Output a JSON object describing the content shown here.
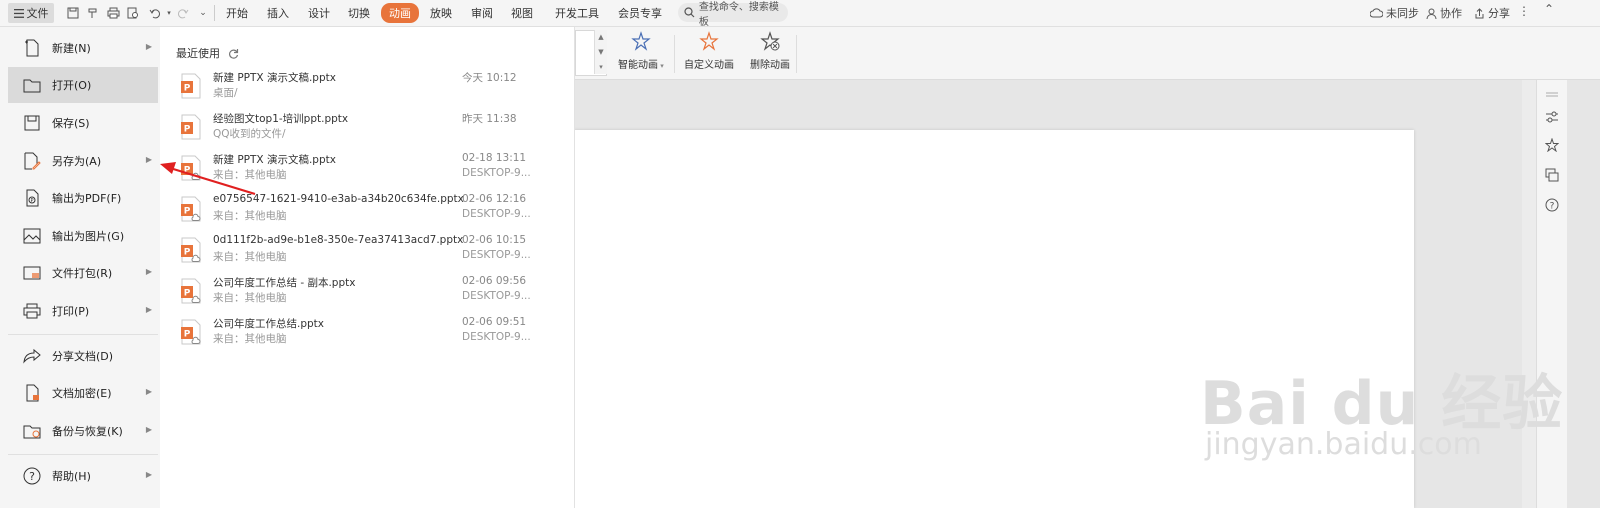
{
  "topbar": {
    "file_label": "文件",
    "tabs": [
      "开始",
      "插入",
      "设计",
      "切换",
      "动画",
      "放映",
      "审阅",
      "视图",
      "开发工具",
      "会员专享"
    ],
    "active_tab": "动画",
    "search_placeholder": "查找命令、搜索模板",
    "sync_label": "未同步",
    "collab_label": "协作",
    "share_label": "分享"
  },
  "ribbon": {
    "smart_anim": "智能动画",
    "custom_anim": "自定义动画",
    "delete_anim": "删除动画"
  },
  "menu": {
    "items": [
      {
        "label": "新建(N)",
        "icon": "new-file-icon",
        "arrow": true
      },
      {
        "label": "打开(O)",
        "icon": "folder-open-icon",
        "arrow": false
      },
      {
        "label": "保存(S)",
        "icon": "save-icon",
        "arrow": false
      },
      {
        "label": "另存为(A)",
        "icon": "save-as-icon",
        "arrow": true
      },
      {
        "label": "输出为PDF(F)",
        "icon": "pdf-icon",
        "arrow": false
      },
      {
        "label": "输出为图片(G)",
        "icon": "image-export-icon",
        "arrow": false
      },
      {
        "label": "文件打包(R)",
        "icon": "package-icon",
        "arrow": true
      },
      {
        "label": "打印(P)",
        "icon": "print-icon",
        "arrow": true
      },
      {
        "label": "分享文档(D)",
        "icon": "share-doc-icon",
        "arrow": false
      },
      {
        "label": "文档加密(E)",
        "icon": "encrypt-icon",
        "arrow": true
      },
      {
        "label": "备份与恢复(K)",
        "icon": "backup-icon",
        "arrow": true
      },
      {
        "label": "帮助(H)",
        "icon": "help-icon",
        "arrow": true
      }
    ]
  },
  "recent": {
    "title": "最近使用",
    "files": [
      {
        "name": "新建 PPTX 演示文稿.pptx",
        "path": "桌面/",
        "time": "今天 10:12",
        "source": ""
      },
      {
        "name": "经验图文top1-培训ppt.pptx",
        "path": "QQ收到的文件/",
        "time": "昨天 11:38",
        "source": ""
      },
      {
        "name": "新建 PPTX 演示文稿.pptx",
        "path": "来自：其他电脑",
        "time": "02-18 13:11",
        "source": "DESKTOP-9..."
      },
      {
        "name": "e0756547-1621-9410-e3ab-a34b20c634fe.pptx",
        "path": "来自：其他电脑",
        "time": "02-06 12:16",
        "source": "DESKTOP-9..."
      },
      {
        "name": "0d111f2b-ad9e-b1e8-350e-7ea37413acd7.pptx",
        "path": "来自：其他电脑",
        "time": "02-06 10:15",
        "source": "DESKTOP-9..."
      },
      {
        "name": "公司年度工作总结 - 副本.pptx",
        "path": "来自：其他电脑",
        "time": "02-06 09:56",
        "source": "DESKTOP-9..."
      },
      {
        "name": "公司年度工作总结.pptx",
        "path": "来自：其他电脑",
        "time": "02-06 09:51",
        "source": "DESKTOP-9..."
      }
    ]
  },
  "watermark": {
    "big": "Bai du 经验",
    "small": "jingyan.baidu.com"
  },
  "colors": {
    "accent": "#e8743b",
    "file_icon": "#e8743b",
    "arrow": "#e02020"
  }
}
